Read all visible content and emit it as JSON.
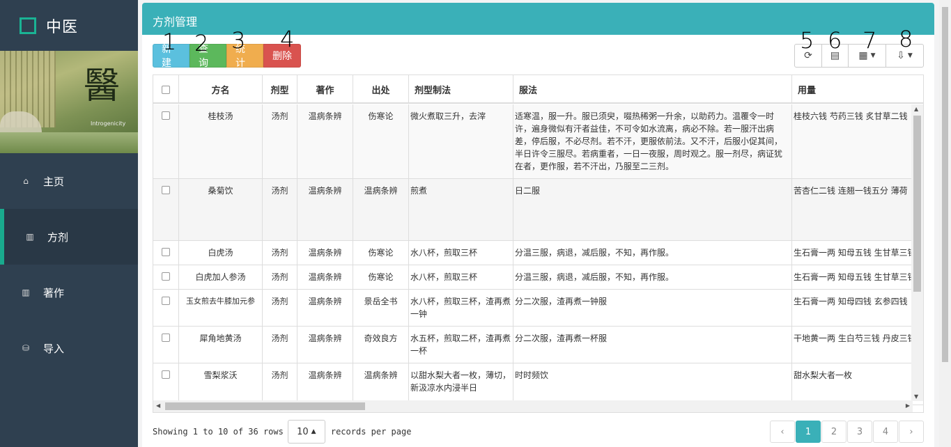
{
  "brand": {
    "title": "中医",
    "banner_glyph": "醫",
    "banner_caption": "Introgenicity"
  },
  "sidebar": {
    "items": [
      {
        "label": "主页",
        "icon": "home-icon",
        "active": false
      },
      {
        "label": "方剂",
        "icon": "bar-chart-icon",
        "active": true
      },
      {
        "label": "著作",
        "icon": "bar-chart-icon",
        "active": false
      },
      {
        "label": "导入",
        "icon": "database-icon",
        "active": false
      }
    ]
  },
  "panel": {
    "title": "方剂管理"
  },
  "toolbar": {
    "new_label": "新建",
    "query_label": "查询",
    "stat_label": "统计",
    "delete_label": "删除"
  },
  "annotations": [
    "1",
    "2",
    "3",
    "4",
    "5",
    "6",
    "7",
    "8"
  ],
  "table": {
    "headers": [
      "方名",
      "剂型",
      "著作",
      "出处",
      "剂型制法",
      "服法",
      "用量"
    ],
    "rows": [
      [
        "桂枝汤",
        "汤剂",
        "温病条辨",
        "伤寒论",
        "微火煮取三升，去滓",
        "适寒温，服一升。服已须臾，啜热稀粥一升余，以助药力。温覆令一时许，遍身微似有汗者益佳，不可令如水流离，病必不除。若一服汗出病差，停后服，不必尽剂。若不汗，更服依前法。又不汗，后服小促其间，半日许令三服尽。若病重者，一日一夜服，周时观之。服一剂尽，病证犹在者，更作服，若不汗出，乃服至二三剂。",
        "桂枝六钱 芍药三钱 炙甘草二钱"
      ],
      [
        "桑菊饮",
        "汤剂",
        "温病条辨",
        "温病条辨",
        "煎煮",
        "日二服",
        "苦杏仁二钱 连翘一钱五分 薄荷"
      ],
      [
        "白虎汤",
        "汤剂",
        "温病条辨",
        "伤寒论",
        "水八杯，煎取三杯",
        "分温三服，病退，减后服，不知，再作服。",
        "生石膏一两 知母五钱 生甘草三钱"
      ],
      [
        "白虎加人参汤",
        "汤剂",
        "温病条辨",
        "伤寒论",
        "水八杯，煎取三杯",
        "分温三服，病退，减后服，不知，再作服。",
        "生石膏一两 知母五钱 生甘草三钱"
      ],
      [
        "玉女煎去牛膝加元参",
        "汤剂",
        "温病条辨",
        "景岳全书",
        "水八杯，煎取三杯，渣再煮一钟",
        "分二次服，渣再煮一钟服",
        "生石膏一两 知母四钱 玄参四钱"
      ],
      [
        "犀角地黄汤",
        "汤剂",
        "温病条辨",
        "奇效良方",
        "水五杯，煎取二杯，渣再煮一杯",
        "分二次服，渣再煮一杯服",
        "干地黄一两 生白芍三钱 丹皮三钱"
      ],
      [
        "雪梨浆沃",
        "汤剂",
        "温病条辨",
        "温病条辨",
        "以甜水梨大者一枚，薄切，新汲凉水内浸半日",
        "时时频饮",
        "甜水梨大者一枚"
      ]
    ]
  },
  "footer": {
    "showing": "Showing 1 to 10 of 36 rows",
    "page_size": "10",
    "per_page_label": "records per page",
    "pages": [
      "1",
      "2",
      "3",
      "4"
    ],
    "prev": "‹",
    "next": "›"
  }
}
